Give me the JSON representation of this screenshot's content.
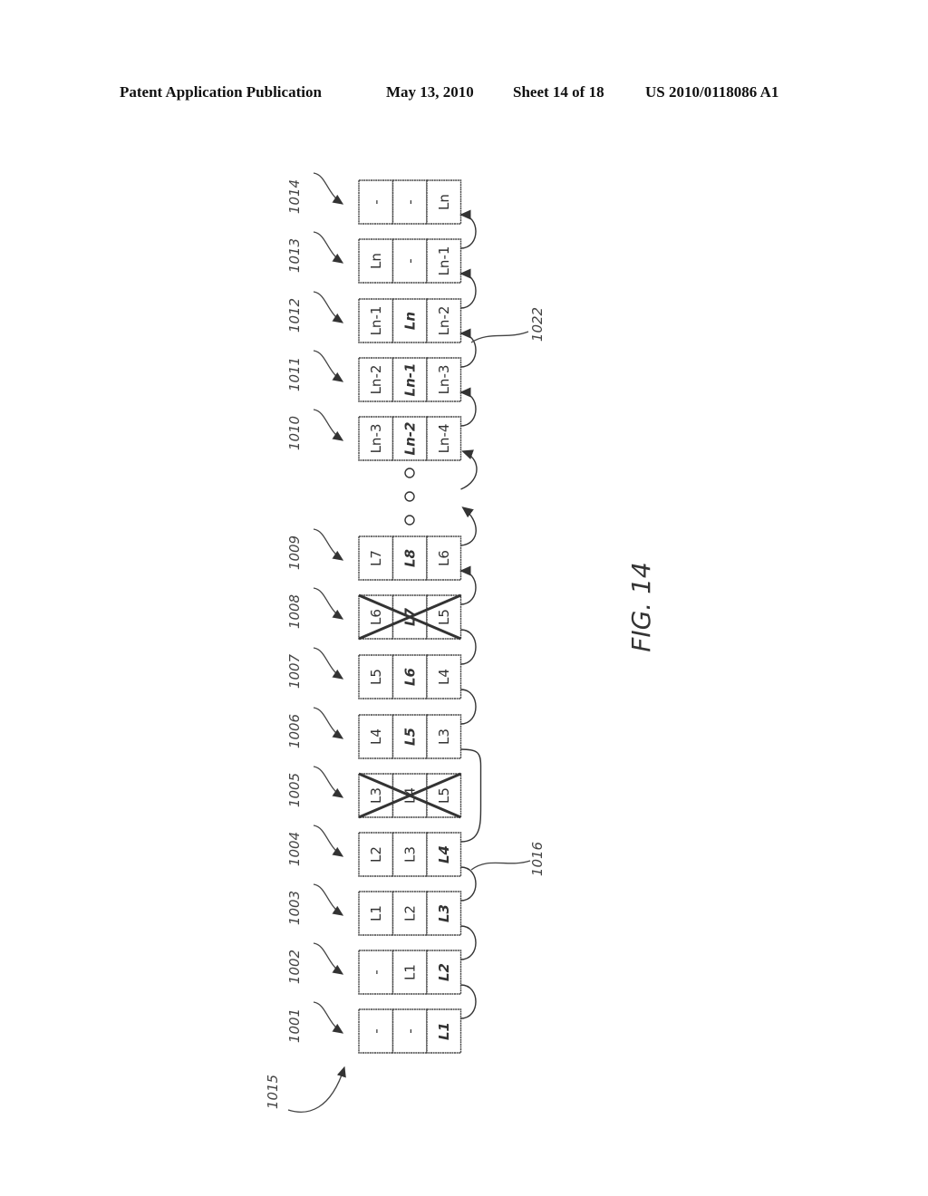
{
  "header": {
    "left": "Patent Application Publication",
    "date": "May 13, 2010",
    "sheet": "Sheet 14 of 18",
    "pub_number": "US 2010/0118086 A1"
  },
  "figure": {
    "label": "FIG. 14",
    "group_labels": {
      "start": "1015",
      "left_bracket": "1016",
      "right_bracket": "1022"
    },
    "records": [
      {
        "ref": "1001",
        "cells": [
          "-",
          "-",
          "L1"
        ],
        "bold": [
          false,
          false,
          true
        ],
        "crossed": false
      },
      {
        "ref": "1002",
        "cells": [
          "-",
          "L1",
          "L2"
        ],
        "bold": [
          false,
          false,
          true
        ],
        "crossed": false
      },
      {
        "ref": "1003",
        "cells": [
          "L1",
          "L2",
          "L3"
        ],
        "bold": [
          false,
          false,
          true
        ],
        "crossed": false
      },
      {
        "ref": "1004",
        "cells": [
          "L2",
          "L3",
          "L4"
        ],
        "bold": [
          false,
          false,
          true
        ],
        "crossed": false
      },
      {
        "ref": "1005",
        "cells": [
          "L3",
          "L4",
          "L5"
        ],
        "bold": [
          false,
          false,
          false
        ],
        "crossed": true
      },
      {
        "ref": "1006",
        "cells": [
          "L4",
          "L5",
          "L3"
        ],
        "bold": [
          false,
          true,
          false
        ],
        "crossed": false
      },
      {
        "ref": "1007",
        "cells": [
          "L5",
          "L6",
          "L4"
        ],
        "bold": [
          false,
          true,
          false
        ],
        "crossed": false
      },
      {
        "ref": "1008",
        "cells": [
          "L6",
          "L7",
          "L5"
        ],
        "bold": [
          false,
          true,
          false
        ],
        "crossed": true
      },
      {
        "ref": "1009",
        "cells": [
          "L7",
          "L8",
          "L6"
        ],
        "bold": [
          false,
          true,
          false
        ],
        "crossed": false
      },
      {
        "ref": "1010",
        "cells": [
          "Ln-3",
          "Ln-2",
          "Ln-4"
        ],
        "bold": [
          false,
          true,
          false
        ],
        "crossed": false
      },
      {
        "ref": "1011",
        "cells": [
          "Ln-2",
          "Ln-1",
          "Ln-3"
        ],
        "bold": [
          false,
          true,
          false
        ],
        "crossed": false
      },
      {
        "ref": "1012",
        "cells": [
          "Ln-1",
          "Ln",
          "Ln-2"
        ],
        "bold": [
          false,
          true,
          false
        ],
        "crossed": false
      },
      {
        "ref": "1013",
        "cells": [
          "Ln",
          "-",
          "Ln-1"
        ],
        "bold": [
          false,
          false,
          false
        ],
        "crossed": false
      },
      {
        "ref": "1014",
        "cells": [
          "-",
          "-",
          "Ln"
        ],
        "bold": [
          false,
          false,
          false
        ],
        "crossed": false
      }
    ],
    "ellipsis_dots": 3
  }
}
